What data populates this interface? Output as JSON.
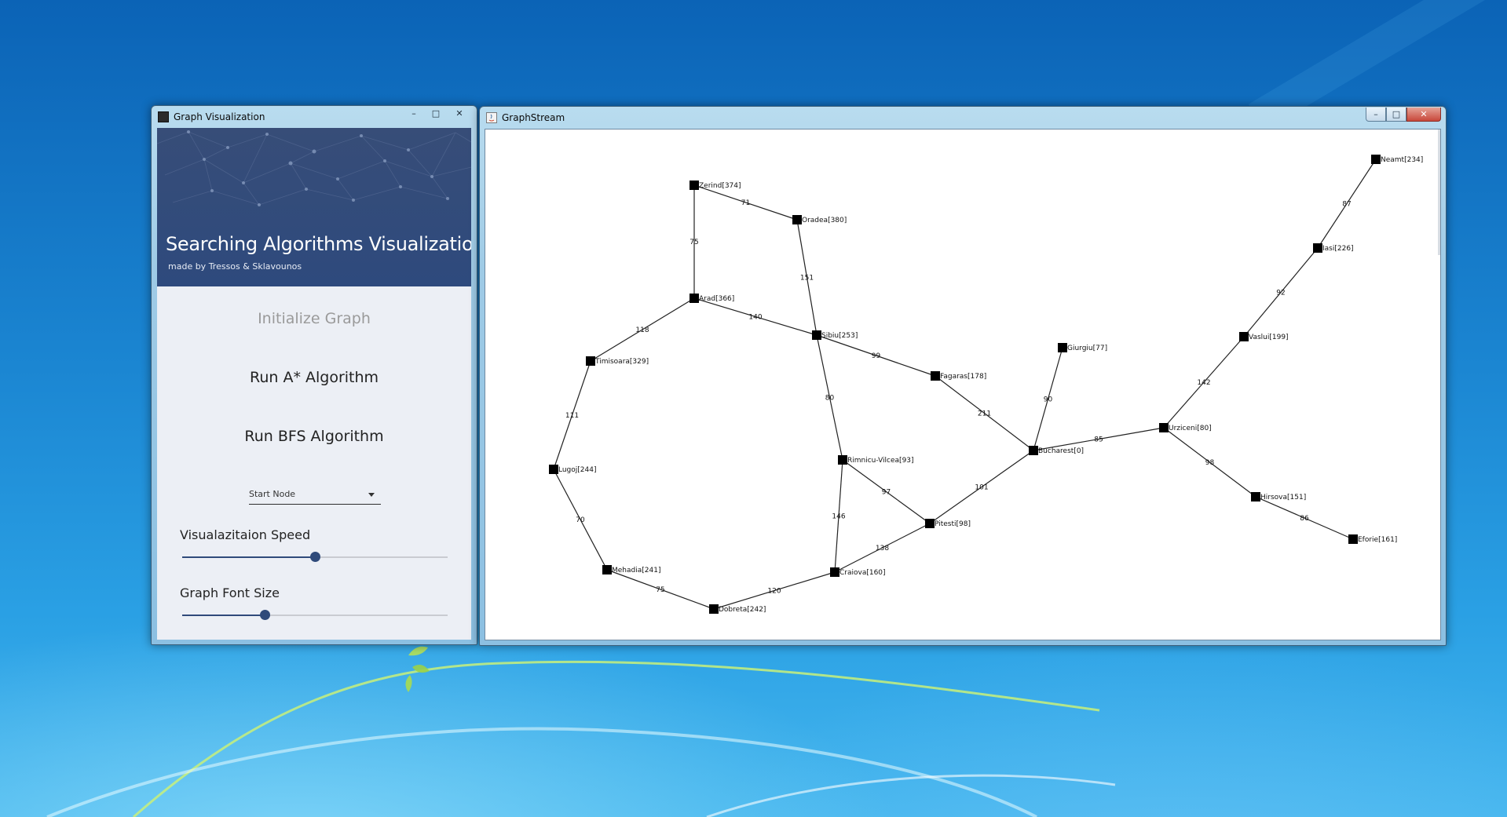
{
  "window_visualization": {
    "title": "Graph Visualization",
    "header": {
      "title": "Searching Algorithms Visualization",
      "subtitle": "made by Tressos & Sklavounos"
    },
    "buttons": {
      "initialize": "Initialize Graph",
      "run_astar": "Run A* Algorithm",
      "run_bfs": "Run BFS Algorithm"
    },
    "start_node": {
      "placeholder": "Start Node"
    },
    "speed_slider": {
      "label": "Visualazitaion Speed",
      "value": 0.5
    },
    "font_slider": {
      "label": "Graph Font Size",
      "value": 0.31
    },
    "controls": {
      "minimize": "–",
      "maximize": "□",
      "close": "✕"
    }
  },
  "window_graphstream": {
    "title": "GraphStream",
    "controls": {
      "minimize": "–",
      "maximize": "□",
      "close": "✕"
    },
    "nodes": [
      {
        "id": "Zerind",
        "label": "Zerind[374]"
      },
      {
        "id": "Oradea",
        "label": "Oradea[380]"
      },
      {
        "id": "Arad",
        "label": "Arad[366]"
      },
      {
        "id": "Sibiu",
        "label": "Sibiu[253]"
      },
      {
        "id": "Timisoara",
        "label": "Timisoara[329]"
      },
      {
        "id": "Lugoj",
        "label": "Lugoj[244]"
      },
      {
        "id": "Mehadia",
        "label": "Mehadia[241]"
      },
      {
        "id": "Dobreta",
        "label": "Dobreta[242]"
      },
      {
        "id": "Craiova",
        "label": "Craiova[160]"
      },
      {
        "id": "Rimnicu",
        "label": "Rimnicu-Vilcea[93]"
      },
      {
        "id": "Pitesti",
        "label": "Pitesti[98]"
      },
      {
        "id": "Fagaras",
        "label": "Fagaras[178]"
      },
      {
        "id": "Bucharest",
        "label": "Bucharest[0]"
      },
      {
        "id": "Giurgiu",
        "label": "Giurgiu[77]"
      },
      {
        "id": "Urziceni",
        "label": "Urziceni[80]"
      },
      {
        "id": "Hirsova",
        "label": "Hirsova[151]"
      },
      {
        "id": "Eforie",
        "label": "Eforie[161]"
      },
      {
        "id": "Vaslui",
        "label": "Vaslui[199]"
      },
      {
        "id": "Iasi",
        "label": "Iasi[226]"
      },
      {
        "id": "Neamt",
        "label": "Neamt[234]"
      }
    ],
    "edges": [
      {
        "from": "Zerind",
        "to": "Oradea",
        "weight": "71"
      },
      {
        "from": "Zerind",
        "to": "Arad",
        "weight": "75"
      },
      {
        "from": "Oradea",
        "to": "Sibiu",
        "weight": "151"
      },
      {
        "from": "Arad",
        "to": "Sibiu",
        "weight": "140"
      },
      {
        "from": "Arad",
        "to": "Timisoara",
        "weight": "118"
      },
      {
        "from": "Timisoara",
        "to": "Lugoj",
        "weight": "111"
      },
      {
        "from": "Lugoj",
        "to": "Mehadia",
        "weight": "70"
      },
      {
        "from": "Mehadia",
        "to": "Dobreta",
        "weight": "75"
      },
      {
        "from": "Dobreta",
        "to": "Craiova",
        "weight": "120"
      },
      {
        "from": "Sibiu",
        "to": "Fagaras",
        "weight": "99"
      },
      {
        "from": "Sibiu",
        "to": "Rimnicu",
        "weight": "80"
      },
      {
        "from": "Rimnicu",
        "to": "Pitesti",
        "weight": "97"
      },
      {
        "from": "Rimnicu",
        "to": "Craiova",
        "weight": "146"
      },
      {
        "from": "Craiova",
        "to": "Pitesti",
        "weight": "138"
      },
      {
        "from": "Fagaras",
        "to": "Bucharest",
        "weight": "211"
      },
      {
        "from": "Pitesti",
        "to": "Bucharest",
        "weight": "101"
      },
      {
        "from": "Bucharest",
        "to": "Giurgiu",
        "weight": "90"
      },
      {
        "from": "Bucharest",
        "to": "Urziceni",
        "weight": "85"
      },
      {
        "from": "Urziceni",
        "to": "Hirsova",
        "weight": "98"
      },
      {
        "from": "Hirsova",
        "to": "Eforie",
        "weight": "86"
      },
      {
        "from": "Urziceni",
        "to": "Vaslui",
        "weight": "142"
      },
      {
        "from": "Vaslui",
        "to": "Iasi",
        "weight": "92"
      },
      {
        "from": "Iasi",
        "to": "Neamt",
        "weight": "87"
      }
    ]
  }
}
